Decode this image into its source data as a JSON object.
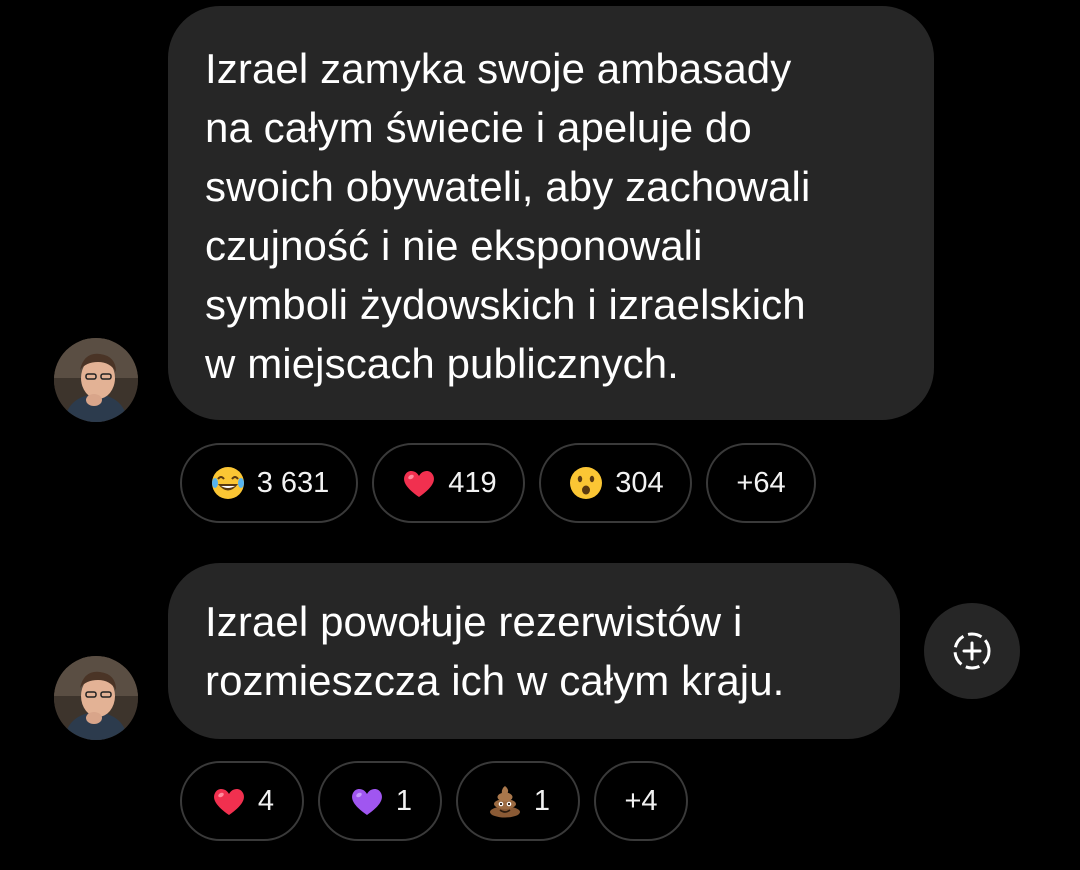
{
  "messages": [
    {
      "text": "Izrael zamyka swoje ambasady\nna całym świecie i apeluje do\nswoich obywateli, aby zachowali\nczujność i nie eksponowali\nsymboli żydowskich i izraelskich\nw miejscach publicznych.",
      "avatar": "user-avatar",
      "reactions": [
        {
          "icon": "joy-emoji-icon",
          "count": "3 631"
        },
        {
          "icon": "red-heart-emoji-icon",
          "count": "419"
        },
        {
          "icon": "surprised-emoji-icon",
          "count": "304"
        },
        {
          "icon": "",
          "count": "+64"
        }
      ]
    },
    {
      "text": "Izrael powołuje rezerwistów i\nrozmieszcza ich w całym kraju.",
      "avatar": "user-avatar",
      "reactions": [
        {
          "icon": "red-heart-emoji-icon",
          "count": "4"
        },
        {
          "icon": "purple-heart-emoji-icon",
          "count": "1"
        },
        {
          "icon": "poop-emoji-icon",
          "count": "1"
        },
        {
          "icon": "",
          "count": "+4"
        }
      ]
    }
  ],
  "add_reaction_icon": "add-reaction-icon",
  "colors": {
    "background": "#000000",
    "bubble": "#262626",
    "reaction_border": "#3a3a3a",
    "text": "#ffffff"
  }
}
